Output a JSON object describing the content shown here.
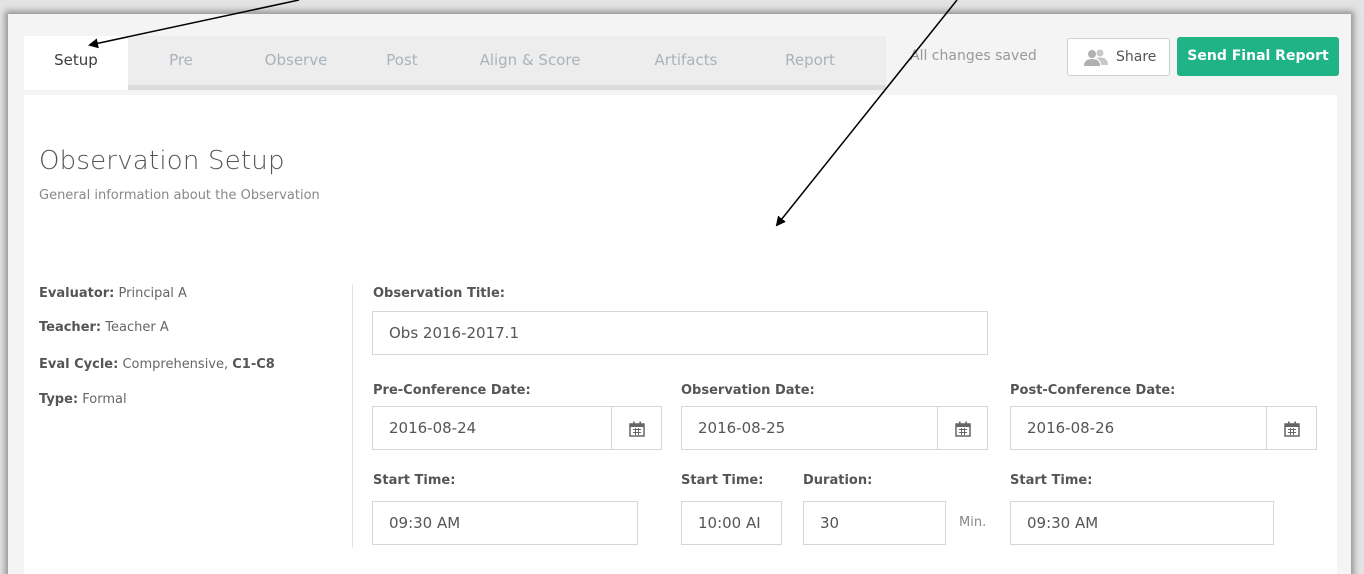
{
  "tabs": [
    {
      "label": "Setup",
      "active": true
    },
    {
      "label": "Pre"
    },
    {
      "label": "Observe"
    },
    {
      "label": "Post"
    },
    {
      "label": "Align & Score"
    },
    {
      "label": "Artifacts"
    },
    {
      "label": "Report"
    }
  ],
  "toolbar": {
    "status": "All changes saved",
    "share_label": "Share",
    "send_label": "Send Final Report",
    "send_color": "#1fb386"
  },
  "page": {
    "title": "Observation Setup",
    "subtitle": "General information about the Observation"
  },
  "info": {
    "evaluator_key": "Evaluator:",
    "evaluator_val": " Principal A",
    "teacher_key": "Teacher:",
    "teacher_val": " Teacher A",
    "cycle_key": "Eval Cycle:",
    "cycle_val": " Comprehensive, ",
    "cycle_code": "C1-C8",
    "type_key": "Type:",
    "type_val": " Formal"
  },
  "form": {
    "title_label": "Observation Title:",
    "title_value": "Obs 2016-2017.1",
    "pre_date_label": "Pre-Conference Date:",
    "pre_date_value": "2016-08-24",
    "obs_date_label": "Observation Date:",
    "obs_date_value": "2016-08-25",
    "post_date_label": "Post-Conference Date:",
    "post_date_value": "2016-08-26",
    "pre_time_label": "Start Time:",
    "pre_time_value": "09:30 AM",
    "obs_time_label": "Start Time:",
    "obs_time_value": "10:00 AI",
    "duration_label": "Duration:",
    "duration_value": "30",
    "duration_unit": "Min.",
    "post_time_label": "Start Time:",
    "post_time_value": "09:30 AM"
  },
  "icons": {
    "calendar": "calendar-icon",
    "share": "people-icon",
    "annotation": "arrow-icon"
  }
}
